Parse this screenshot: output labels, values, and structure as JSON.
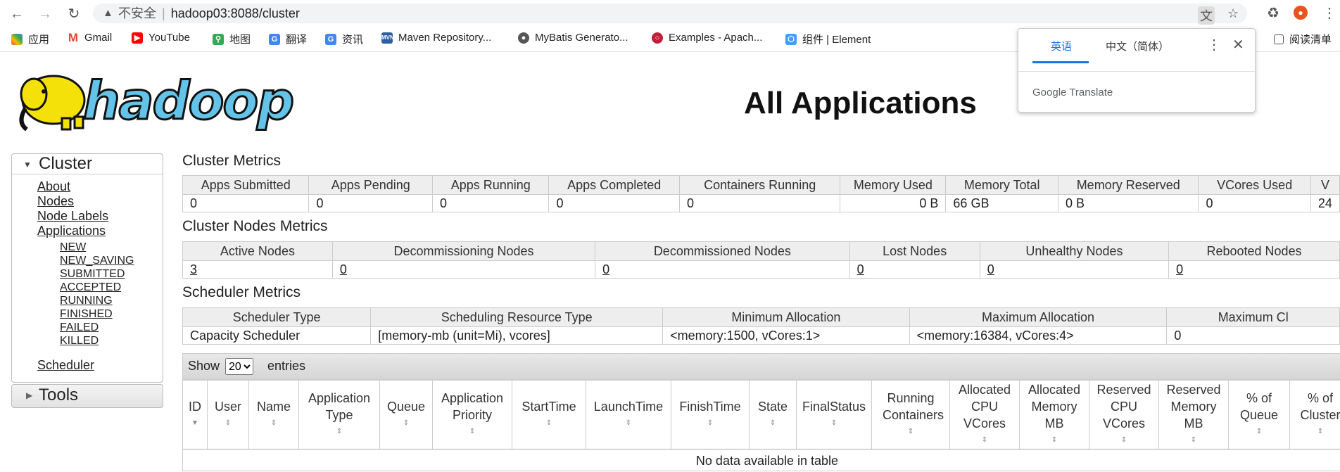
{
  "browser": {
    "address_insecure": "不安全",
    "address_url": "hadoop03:8088/cluster",
    "bookmarks": [
      "应用",
      "Gmail",
      "YouTube",
      "地图",
      "翻译",
      "资讯",
      "Maven Repository...",
      "MyBatis Generato...",
      "Examples - Apach...",
      "组件 | Element",
      "阅读清单"
    ]
  },
  "translate_popup": {
    "tab_source": "英语",
    "tab_target": "中文（简体）",
    "footer": "Google Translate"
  },
  "page": {
    "logo_text": "hadoop",
    "title": "All Applications"
  },
  "sidebar": {
    "cluster_label": "Cluster",
    "links": [
      "About",
      "Nodes",
      "Node Labels",
      "Applications"
    ],
    "app_states": [
      "NEW",
      "NEW_SAVING",
      "SUBMITTED",
      "ACCEPTED",
      "RUNNING",
      "FINISHED",
      "FAILED",
      "KILLED"
    ],
    "scheduler": "Scheduler",
    "tools_label": "Tools"
  },
  "cluster_metrics": {
    "title": "Cluster Metrics",
    "headers": [
      "Apps Submitted",
      "Apps Pending",
      "Apps Running",
      "Apps Completed",
      "Containers Running",
      "Memory Used",
      "Memory Total",
      "Memory Reserved",
      "VCores Used",
      "V"
    ],
    "values": [
      "0",
      "0",
      "0",
      "0",
      "0",
      "0 B",
      "66 GB",
      "0 B",
      "0",
      "24"
    ]
  },
  "nodes_metrics": {
    "title": "Cluster Nodes Metrics",
    "headers": [
      "Active Nodes",
      "Decommissioning Nodes",
      "Decommissioned Nodes",
      "Lost Nodes",
      "Unhealthy Nodes",
      "Rebooted Nodes"
    ],
    "values": [
      "3",
      "0",
      "0",
      "0",
      "0",
      "0"
    ]
  },
  "scheduler_metrics": {
    "title": "Scheduler Metrics",
    "headers": [
      "Scheduler Type",
      "Scheduling Resource Type",
      "Minimum Allocation",
      "Maximum Allocation",
      "Maximum Cl"
    ],
    "values": [
      "Capacity Scheduler",
      "[memory-mb (unit=Mi), vcores]",
      "<memory:1500, vCores:1>",
      "<memory:16384, vCores:4>",
      "0"
    ]
  },
  "apps_table": {
    "show_label": "Show",
    "entries_value": "20",
    "entries_label": "entries",
    "columns": [
      "ID",
      "User",
      "Name",
      "Application Type",
      "Queue",
      "Application Priority",
      "StartTime",
      "LaunchTime",
      "FinishTime",
      "State",
      "FinalStatus",
      "Running Containers",
      "Allocated CPU VCores",
      "Allocated Memory MB",
      "Reserved CPU VCores",
      "Reserved Memory MB",
      "% of Queue",
      "% of Cluster"
    ],
    "empty_message": "No data available in table"
  }
}
